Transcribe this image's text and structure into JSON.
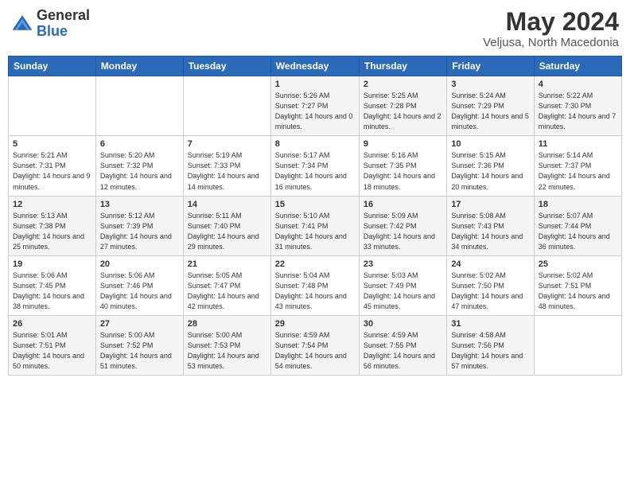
{
  "header": {
    "logo_general": "General",
    "logo_blue": "Blue",
    "month_title": "May 2024",
    "location": "Veljusa, North Macedonia"
  },
  "weekdays": [
    "Sunday",
    "Monday",
    "Tuesday",
    "Wednesday",
    "Thursday",
    "Friday",
    "Saturday"
  ],
  "weeks": [
    [
      {
        "day": "",
        "sunrise": "",
        "sunset": "",
        "daylight": ""
      },
      {
        "day": "",
        "sunrise": "",
        "sunset": "",
        "daylight": ""
      },
      {
        "day": "",
        "sunrise": "",
        "sunset": "",
        "daylight": ""
      },
      {
        "day": "1",
        "sunrise": "Sunrise: 5:26 AM",
        "sunset": "Sunset: 7:27 PM",
        "daylight": "Daylight: 14 hours and 0 minutes."
      },
      {
        "day": "2",
        "sunrise": "Sunrise: 5:25 AM",
        "sunset": "Sunset: 7:28 PM",
        "daylight": "Daylight: 14 hours and 2 minutes."
      },
      {
        "day": "3",
        "sunrise": "Sunrise: 5:24 AM",
        "sunset": "Sunset: 7:29 PM",
        "daylight": "Daylight: 14 hours and 5 minutes."
      },
      {
        "day": "4",
        "sunrise": "Sunrise: 5:22 AM",
        "sunset": "Sunset: 7:30 PM",
        "daylight": "Daylight: 14 hours and 7 minutes."
      }
    ],
    [
      {
        "day": "5",
        "sunrise": "Sunrise: 5:21 AM",
        "sunset": "Sunset: 7:31 PM",
        "daylight": "Daylight: 14 hours and 9 minutes."
      },
      {
        "day": "6",
        "sunrise": "Sunrise: 5:20 AM",
        "sunset": "Sunset: 7:32 PM",
        "daylight": "Daylight: 14 hours and 12 minutes."
      },
      {
        "day": "7",
        "sunrise": "Sunrise: 5:19 AM",
        "sunset": "Sunset: 7:33 PM",
        "daylight": "Daylight: 14 hours and 14 minutes."
      },
      {
        "day": "8",
        "sunrise": "Sunrise: 5:17 AM",
        "sunset": "Sunset: 7:34 PM",
        "daylight": "Daylight: 14 hours and 16 minutes."
      },
      {
        "day": "9",
        "sunrise": "Sunrise: 5:16 AM",
        "sunset": "Sunset: 7:35 PM",
        "daylight": "Daylight: 14 hours and 18 minutes."
      },
      {
        "day": "10",
        "sunrise": "Sunrise: 5:15 AM",
        "sunset": "Sunset: 7:36 PM",
        "daylight": "Daylight: 14 hours and 20 minutes."
      },
      {
        "day": "11",
        "sunrise": "Sunrise: 5:14 AM",
        "sunset": "Sunset: 7:37 PM",
        "daylight": "Daylight: 14 hours and 22 minutes."
      }
    ],
    [
      {
        "day": "12",
        "sunrise": "Sunrise: 5:13 AM",
        "sunset": "Sunset: 7:38 PM",
        "daylight": "Daylight: 14 hours and 25 minutes."
      },
      {
        "day": "13",
        "sunrise": "Sunrise: 5:12 AM",
        "sunset": "Sunset: 7:39 PM",
        "daylight": "Daylight: 14 hours and 27 minutes."
      },
      {
        "day": "14",
        "sunrise": "Sunrise: 5:11 AM",
        "sunset": "Sunset: 7:40 PM",
        "daylight": "Daylight: 14 hours and 29 minutes."
      },
      {
        "day": "15",
        "sunrise": "Sunrise: 5:10 AM",
        "sunset": "Sunset: 7:41 PM",
        "daylight": "Daylight: 14 hours and 31 minutes."
      },
      {
        "day": "16",
        "sunrise": "Sunrise: 5:09 AM",
        "sunset": "Sunset: 7:42 PM",
        "daylight": "Daylight: 14 hours and 33 minutes."
      },
      {
        "day": "17",
        "sunrise": "Sunrise: 5:08 AM",
        "sunset": "Sunset: 7:43 PM",
        "daylight": "Daylight: 14 hours and 34 minutes."
      },
      {
        "day": "18",
        "sunrise": "Sunrise: 5:07 AM",
        "sunset": "Sunset: 7:44 PM",
        "daylight": "Daylight: 14 hours and 36 minutes."
      }
    ],
    [
      {
        "day": "19",
        "sunrise": "Sunrise: 5:06 AM",
        "sunset": "Sunset: 7:45 PM",
        "daylight": "Daylight: 14 hours and 38 minutes."
      },
      {
        "day": "20",
        "sunrise": "Sunrise: 5:06 AM",
        "sunset": "Sunset: 7:46 PM",
        "daylight": "Daylight: 14 hours and 40 minutes."
      },
      {
        "day": "21",
        "sunrise": "Sunrise: 5:05 AM",
        "sunset": "Sunset: 7:47 PM",
        "daylight": "Daylight: 14 hours and 42 minutes."
      },
      {
        "day": "22",
        "sunrise": "Sunrise: 5:04 AM",
        "sunset": "Sunset: 7:48 PM",
        "daylight": "Daylight: 14 hours and 43 minutes."
      },
      {
        "day": "23",
        "sunrise": "Sunrise: 5:03 AM",
        "sunset": "Sunset: 7:49 PM",
        "daylight": "Daylight: 14 hours and 45 minutes."
      },
      {
        "day": "24",
        "sunrise": "Sunrise: 5:02 AM",
        "sunset": "Sunset: 7:50 PM",
        "daylight": "Daylight: 14 hours and 47 minutes."
      },
      {
        "day": "25",
        "sunrise": "Sunrise: 5:02 AM",
        "sunset": "Sunset: 7:51 PM",
        "daylight": "Daylight: 14 hours and 48 minutes."
      }
    ],
    [
      {
        "day": "26",
        "sunrise": "Sunrise: 5:01 AM",
        "sunset": "Sunset: 7:51 PM",
        "daylight": "Daylight: 14 hours and 50 minutes."
      },
      {
        "day": "27",
        "sunrise": "Sunrise: 5:00 AM",
        "sunset": "Sunset: 7:52 PM",
        "daylight": "Daylight: 14 hours and 51 minutes."
      },
      {
        "day": "28",
        "sunrise": "Sunrise: 5:00 AM",
        "sunset": "Sunset: 7:53 PM",
        "daylight": "Daylight: 14 hours and 53 minutes."
      },
      {
        "day": "29",
        "sunrise": "Sunrise: 4:59 AM",
        "sunset": "Sunset: 7:54 PM",
        "daylight": "Daylight: 14 hours and 54 minutes."
      },
      {
        "day": "30",
        "sunrise": "Sunrise: 4:59 AM",
        "sunset": "Sunset: 7:55 PM",
        "daylight": "Daylight: 14 hours and 56 minutes."
      },
      {
        "day": "31",
        "sunrise": "Sunrise: 4:58 AM",
        "sunset": "Sunset: 7:56 PM",
        "daylight": "Daylight: 14 hours and 57 minutes."
      },
      {
        "day": "",
        "sunrise": "",
        "sunset": "",
        "daylight": ""
      }
    ]
  ]
}
